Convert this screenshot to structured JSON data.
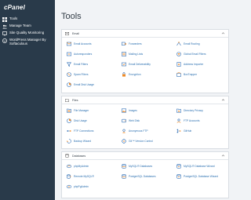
{
  "brand": {
    "logo_text": "cPanel"
  },
  "sidebar": {
    "items": [
      {
        "label": "Tools",
        "icon": "grid-icon"
      },
      {
        "label": "Manage Team",
        "icon": "team-icon"
      },
      {
        "label": "Site Quality Monitoring",
        "icon": "monitor-icon"
      },
      {
        "label": "WordPress Manager By Softaculous",
        "icon": "wordpress-icon"
      }
    ]
  },
  "page": {
    "title": "Tools"
  },
  "sections": {
    "email": {
      "title": "Email",
      "tools": [
        {
          "label": "Email Accounts",
          "icon": "email-accounts-icon"
        },
        {
          "label": "Forwarders",
          "icon": "forwarders-icon"
        },
        {
          "label": "Email Routing",
          "icon": "email-routing-icon"
        },
        {
          "label": "Autoresponders",
          "icon": "autoresponders-icon"
        },
        {
          "label": "Mailing Lists",
          "icon": "mailing-lists-icon"
        },
        {
          "label": "Global Email Filters",
          "icon": "global-filters-icon"
        },
        {
          "label": "Email Filters",
          "icon": "email-filters-icon"
        },
        {
          "label": "Email Deliverability",
          "icon": "deliverability-icon"
        },
        {
          "label": "Address Importer",
          "icon": "address-importer-icon"
        },
        {
          "label": "Spam Filters",
          "icon": "spam-filters-icon"
        },
        {
          "label": "Encryption",
          "icon": "encryption-icon"
        },
        {
          "label": "BoxTrapper",
          "icon": "boxtrapper-icon"
        },
        {
          "label": "Email Disk Usage",
          "icon": "email-disk-usage-icon"
        }
      ]
    },
    "files": {
      "title": "Files",
      "tools": [
        {
          "label": "File Manager",
          "icon": "file-manager-icon"
        },
        {
          "label": "Images",
          "icon": "images-icon"
        },
        {
          "label": "Directory Privacy",
          "icon": "directory-privacy-icon"
        },
        {
          "label": "Disk Usage",
          "icon": "disk-usage-icon"
        },
        {
          "label": "Web Disk",
          "icon": "web-disk-icon"
        },
        {
          "label": "FTP Accounts",
          "icon": "ftp-accounts-icon"
        },
        {
          "label": "FTP Connections",
          "icon": "ftp-connections-icon"
        },
        {
          "label": "Anonymous FTP",
          "icon": "anonymous-ftp-icon"
        },
        {
          "label": "GitHub",
          "icon": "git-icon"
        },
        {
          "label": "Backup Wizard",
          "icon": "backup-wizard-icon"
        },
        {
          "label": "Git™ Version Control",
          "icon": "git-version-control-icon"
        }
      ]
    },
    "databases": {
      "title": "Databases",
      "tools": [
        {
          "label": "phpMyAdmin",
          "icon": "phpmyadmin-icon"
        },
        {
          "label": "MySQL® Databases",
          "icon": "mysql-databases-icon"
        },
        {
          "label": "MySQL® Database Wizard",
          "icon": "mysql-wizard-icon"
        },
        {
          "label": "Remote MySQL®",
          "icon": "remote-mysql-icon"
        },
        {
          "label": "PostgreSQL Databases",
          "icon": "postgresql-databases-icon"
        },
        {
          "label": "PostgreSQL Database Wizard",
          "icon": "postgresql-wizard-icon"
        },
        {
          "label": "phpPgAdmin",
          "icon": "phppgadmin-icon"
        }
      ]
    }
  },
  "colors": {
    "sidebar_bg": "#293a4a",
    "link": "#2a6fb0",
    "icon_orange": "#f08a24",
    "icon_blue": "#2e6db4"
  }
}
